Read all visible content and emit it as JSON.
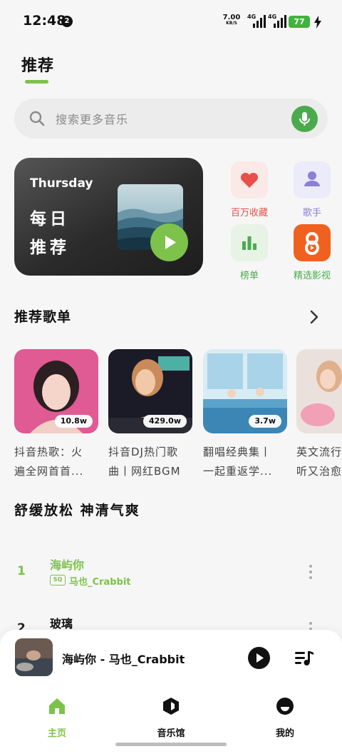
{
  "status_bar": {
    "time": "12:48",
    "notification_count": "2",
    "net_speed_value": "7.00",
    "net_speed_unit": "KB/S",
    "sim1_label": "4G",
    "sim2_label": "4G",
    "battery": "77"
  },
  "header": {
    "tab_title": "推荐"
  },
  "search": {
    "placeholder": "搜索更多音乐"
  },
  "daily": {
    "day": "Thursday",
    "title_line1": "每日",
    "title_line2": "推荐"
  },
  "quick_links": [
    {
      "label": "百万收藏",
      "icon": "heart-icon",
      "color": "#e8504a"
    },
    {
      "label": "歌手",
      "icon": "singer-icon",
      "color": "#8b7fd6"
    },
    {
      "label": "榜单",
      "icon": "chart-bars-icon",
      "color": "#4caa4e"
    },
    {
      "label": "精选影视",
      "icon": "video-app-icon",
      "color": "#f0611f"
    }
  ],
  "recommended": {
    "title": "推荐歌单",
    "playlists": [
      {
        "count": "10.8w",
        "title_line1": "抖音热歌：火",
        "title_line2": "遍全网首首..."
      },
      {
        "count": "429.0w",
        "title_line1": "抖音DJ热门歌",
        "title_line2": "曲丨网红BGM"
      },
      {
        "count": "3.7w",
        "title_line1": "翻唱经典集丨",
        "title_line2": "一起重返学..."
      },
      {
        "count": "",
        "title_line1": "英文流行",
        "title_line2": "听又治愈"
      }
    ]
  },
  "mood": {
    "title": "舒缓放松 神清气爽"
  },
  "songs": [
    {
      "num": "1",
      "name": "海屿你",
      "quality": "SQ",
      "artist": "马也_Crabbit"
    },
    {
      "num": "2",
      "name": "玻璃"
    }
  ],
  "player": {
    "title": "海屿你 - 马也_Crabbit"
  },
  "nav": {
    "home": "主页",
    "music_hall": "音乐馆",
    "mine": "我的"
  },
  "colors": {
    "accent": "#7dc24b",
    "active_nav": "#7dc24b"
  }
}
